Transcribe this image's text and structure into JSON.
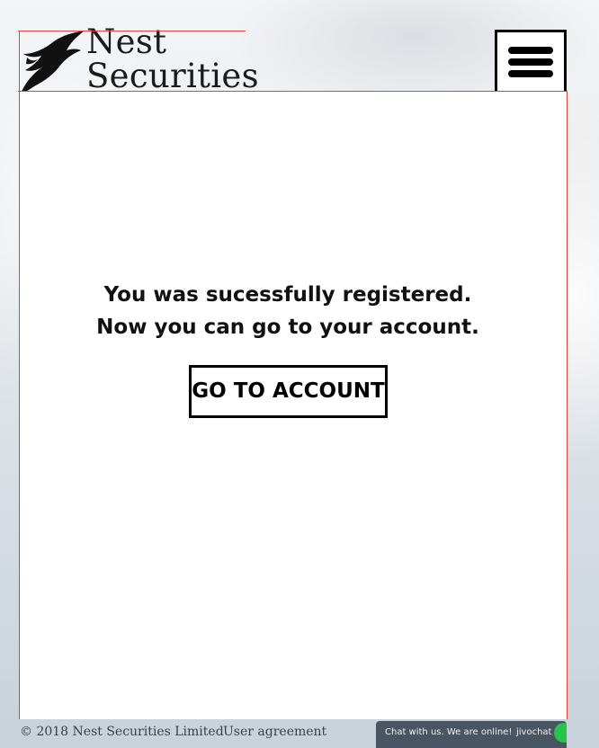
{
  "header": {
    "brand_line1": "Nest",
    "brand_line2": "Securities",
    "menu_icon": "hamburger-menu-icon"
  },
  "main": {
    "message_line1": "You was sucessfully registered.",
    "message_line2": "Now you can go to your account.",
    "go_button_label": "GO TO ACCOUNT"
  },
  "footer": {
    "copyright": "© 2018 Nest Securities Limited",
    "agreement_link": "User agreement"
  },
  "chat": {
    "text": "Chat with us. We are online!",
    "brand": "jivochat",
    "status_color": "#29c24a"
  },
  "colors": {
    "guide_line": "#d9453f",
    "text": "#111111",
    "chat_bg": "#4a5564"
  }
}
